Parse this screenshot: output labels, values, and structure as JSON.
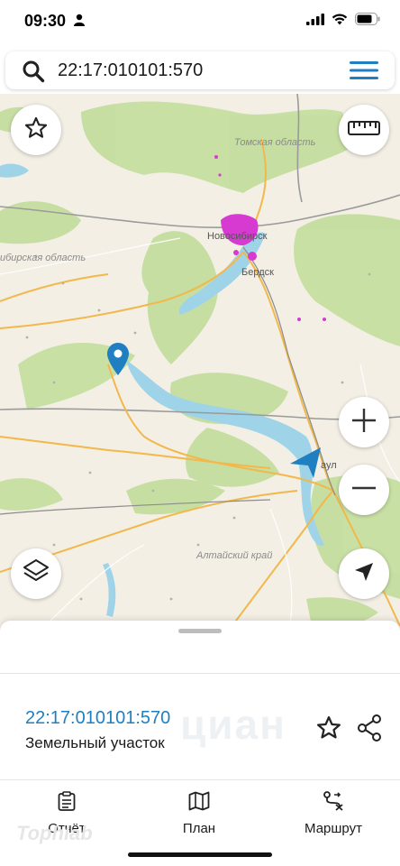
{
  "status_bar": {
    "time": "09:30",
    "icons": [
      "person-icon",
      "signal-icon",
      "wifi-icon",
      "battery-icon"
    ]
  },
  "search": {
    "value": "22:17:010101:570",
    "icons": [
      "search-icon",
      "menu-icon"
    ]
  },
  "map": {
    "labels": {
      "tomsk_region": "Томская область",
      "novosibirsk_region": "ибирская область",
      "altai_krai": "Алтайский край",
      "novosibirsk": "Новосибирск",
      "berdsk": "Бердск",
      "barnaul_partial": "аул"
    },
    "controls": [
      "favorite-star-icon",
      "ruler-icon",
      "zoom-in-icon",
      "zoom-out-icon",
      "layers-icon",
      "locate-arrow-icon"
    ],
    "colors": {
      "land": "#f3efe5",
      "forest": "#c5dea0",
      "water": "#9fd3e8",
      "road": "#f2b84b",
      "city": "#d63ad0",
      "marker": "#1f7fc0"
    }
  },
  "sheet": {
    "cadastral_number": "22:17:010101:570",
    "object_type": "Земельный участок",
    "watermark": "циан",
    "icons": [
      "favorite-icon",
      "share-icon"
    ]
  },
  "bottom_nav": {
    "items": [
      {
        "label": "Отчёт",
        "icon": "report-icon"
      },
      {
        "label": "План",
        "icon": "plan-map-icon"
      },
      {
        "label": "Маршрут",
        "icon": "route-icon"
      }
    ],
    "brand": "Tophlab"
  }
}
